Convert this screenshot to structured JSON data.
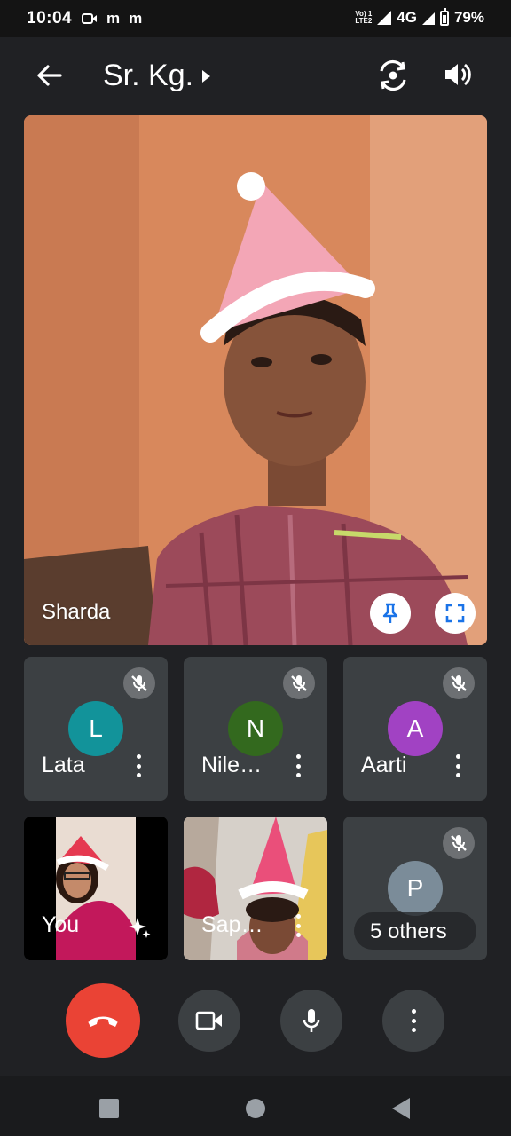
{
  "status_bar": {
    "time": "10:04",
    "notification_icons": [
      "video-call-icon",
      "m-icon",
      "m-icon"
    ],
    "m1": "m",
    "m2": "m",
    "volte_line1": "Vo) 1",
    "volte_line2": "LTE2",
    "network": "4G",
    "battery": "79%"
  },
  "app_bar": {
    "meeting_title": "Sr. Kg.",
    "actions": [
      "back-arrow-icon",
      "switch-camera-icon",
      "speaker-volume-icon"
    ]
  },
  "main_tile": {
    "participant_name": "Sharda",
    "actions": [
      "pin-icon",
      "fullscreen-icon"
    ]
  },
  "participants": [
    {
      "name": "Lata",
      "initial": "L",
      "avatar_color": "#12939a",
      "muted": true
    },
    {
      "name": "Nile…",
      "initial": "N",
      "avatar_color": "#33691e",
      "muted": true
    },
    {
      "name": "Aarti",
      "initial": "A",
      "avatar_color": "#a142c3",
      "muted": true
    },
    {
      "name": "You",
      "type": "video",
      "action": "visual-effects-icon"
    },
    {
      "name": "Sap…",
      "type": "video"
    },
    {
      "label": "5 others",
      "initial": "P",
      "avatar_color": "#7b8c99",
      "muted": true
    }
  ],
  "call_controls": [
    "end-call-icon",
    "camera-icon",
    "microphone-icon",
    "more-options-icon"
  ],
  "colors": {
    "background": "#202124",
    "tile": "#3c4043",
    "end_call": "#ea4335"
  }
}
